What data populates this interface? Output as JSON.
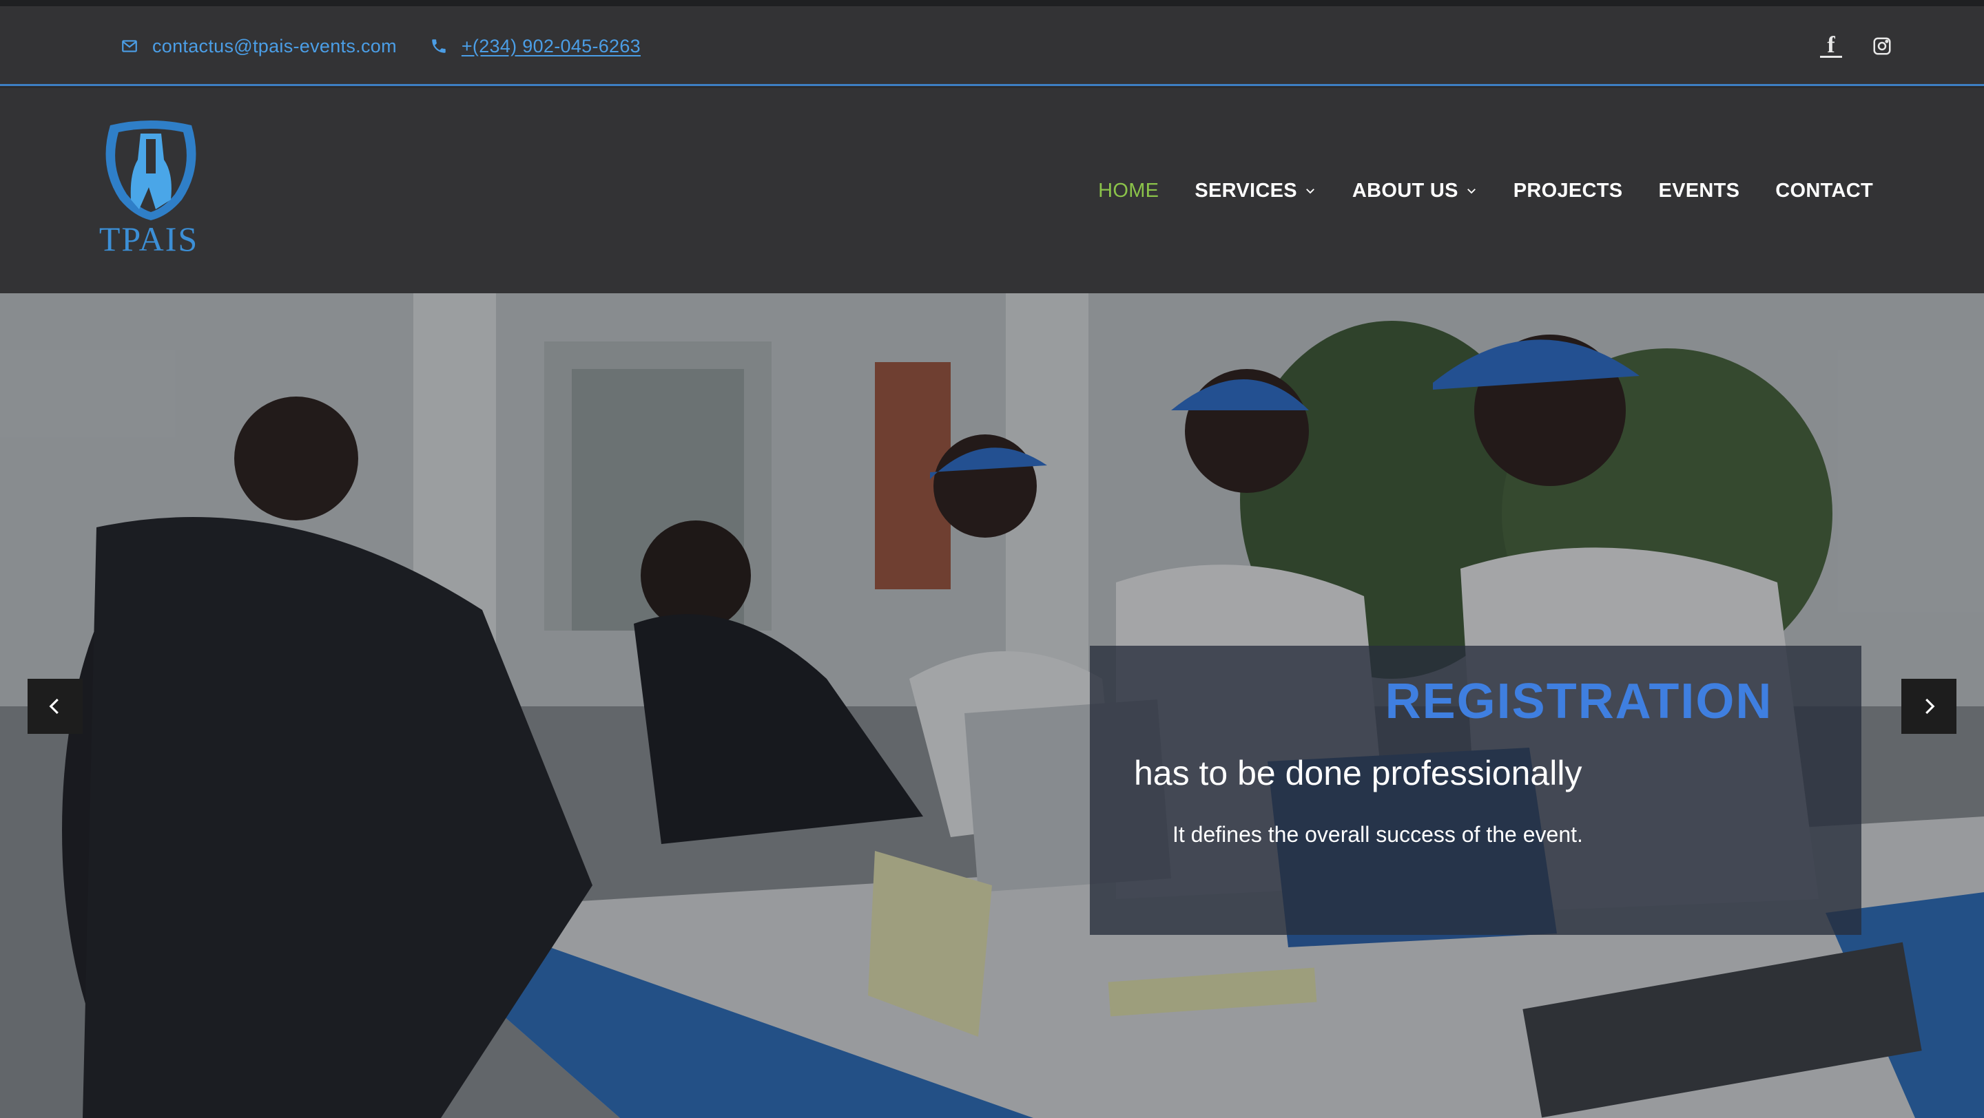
{
  "topbar": {
    "email": "contactus@tpais-events.com",
    "phone": "+(234) 902-045-6263",
    "icons": [
      "envelope-icon",
      "phone-icon"
    ],
    "social": [
      "facebook-icon",
      "instagram-icon"
    ]
  },
  "header": {
    "logo_text": "TPAIS",
    "nav": [
      {
        "label": "HOME",
        "active": true
      },
      {
        "label": "SERVICES",
        "dropdown": true
      },
      {
        "label": "ABOUT US",
        "dropdown": true
      },
      {
        "label": "PROJECTS"
      },
      {
        "label": "EVENTS"
      },
      {
        "label": "CONTACT"
      }
    ]
  },
  "hero": {
    "title": "REGISTRATION",
    "subtitle": "has to be done professionally",
    "description": "It defines the overall success of the event.",
    "controls": [
      "chevron-left-icon",
      "chevron-right-icon"
    ]
  },
  "colors": {
    "accent": "#4b9ee6",
    "nav_active": "#8bc34a",
    "header_bg": "#333335",
    "caption_title": "#3f7fe0"
  }
}
